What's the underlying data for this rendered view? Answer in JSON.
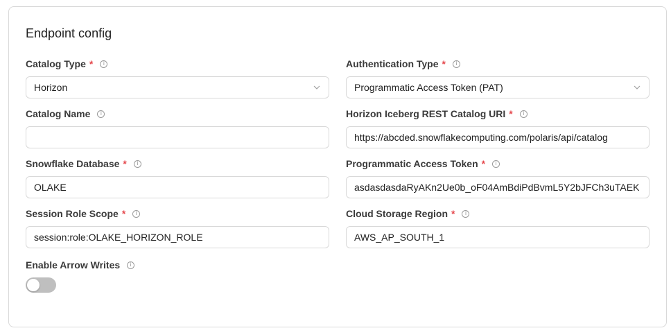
{
  "card": {
    "title": "Endpoint config"
  },
  "info_glyph": "i",
  "required_mark": "*",
  "fields": {
    "catalog_type": {
      "label": "Catalog Type",
      "value": "Horizon",
      "required": true
    },
    "authentication_type": {
      "label": "Authentication Type",
      "value": "Programmatic Access Token (PAT)",
      "required": true
    },
    "catalog_name": {
      "label": "Catalog Name",
      "value": "",
      "required": false
    },
    "catalog_uri": {
      "label": "Horizon Iceberg REST Catalog URI",
      "value": "https://abcded.snowflakecomputing.com/polaris/api/catalog",
      "required": true
    },
    "snowflake_database": {
      "label": "Snowflake Database",
      "value": "OLAKE",
      "required": true
    },
    "pat": {
      "label": "Programmatic Access Token",
      "value": "asdasdasdaRyAKn2Ue0b_oF04AmBdiPdBvmL5Y2bJFCh3uTAEK",
      "required": true
    },
    "session_role_scope": {
      "label": "Session Role Scope",
      "value": "session:role:OLAKE_HORIZON_ROLE",
      "required": true
    },
    "cloud_storage_region": {
      "label": "Cloud Storage Region",
      "value": "AWS_AP_SOUTH_1",
      "required": true
    },
    "enable_arrow_writes": {
      "label": "Enable Arrow Writes",
      "enabled": false,
      "required": false
    }
  },
  "colors": {
    "required": "#e5484d",
    "border": "#d9d9d9",
    "toggle_off": "#bfbfbf"
  }
}
